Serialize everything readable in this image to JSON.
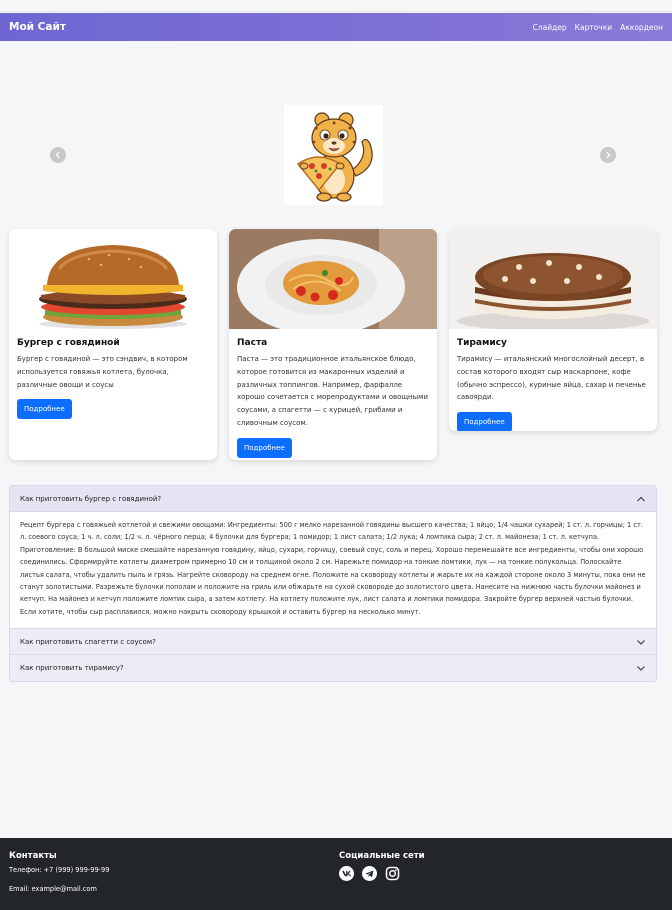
{
  "navbar": {
    "brand": "Мой Сайт",
    "links": [
      "Слайдер",
      "Карточки",
      "Аккордеон"
    ]
  },
  "cards": [
    {
      "title": "Бургер с говядиной",
      "text": "Бургер с говядиной — это сэндвич, в котором используется говяжья котлета, булочка, различные овощи и соусы",
      "button": "Подробнее"
    },
    {
      "title": "Паста",
      "text": "Паста — это традиционное итальянское блюдо, которое готовится из макаронных изделий и различных топпингов. Например, фарфалле хорошо сочетается с морепродуктами и овощными соусами, а спагетти — с курицей, грибами и сливочным соусом.",
      "button": "Подробнее"
    },
    {
      "title": "Тирамису",
      "text": "Тирамису — итальянский многослойный десерт, в состав которого входят сыр маскарпоне, кофе (обычно эспрессо), куриные яйца, сахар и печенье савоярди.",
      "button": "Подробнее"
    }
  ],
  "accordion": {
    "items": [
      {
        "title": "Как приготовить бургер с говядиной?",
        "open": true,
        "body": "Рецепт бургера с говяжьей котлетой и свежими овощами: Ингредиенты: 500 г мелко нарезанной говядины высшего качества; 1 яйцо; 1/4 чашки сухарей; 1 ст. л. горчицы; 1 ст. л. соевого соуса; 1 ч. л. соли; 1/2 ч. л. чёрного перца; 4 булочки для бургера; 1 помидор; 1 лист салата; 1/2 лука; 4 ломтика сыра; 2 ст. л. майонеза; 1 ст. л. кетчупа. Приготовление: В большой миске смешайте нарезанную говядину, яйцо, сухари, горчицу, соевый соус, соль и перец. Хорошо перемешайте все ингредиенты, чтобы они хорошо соединились. Сформируйте котлеты диаметром примерно 10 см и толщиной около 2 см. Нарежьте помидор на тонкие ломтики, лук — на тонкие полукольца. Полоскайте листья салата, чтобы удалить пыль и грязь. Нагрейте сковороду на среднем огне. Положите на сковороду котлеты и жарьте их на каждой стороне около 3 минуты, пока они не станут золотистыми. Разрежьте булочки пополам и положите на гриль или обжарьте на сухой сковороде до золотистого цвета. Нанесите на нижнюю часть булочки майонез и кетчуп. На майонез и кетчуп положите ломтик сыра, а затем котлету. На котлету положите лук, лист салата и ломтики помидора. Закройте бургер верхней частью булочки. Если хотите, чтобы сыр расплавился, можно накрыть сковороду крышкой и оставить бургер на несколько минут."
      },
      {
        "title": "Как приготовить спагетти с соусом?",
        "open": false
      },
      {
        "title": "Как приготовить тирамису?",
        "open": false
      }
    ]
  },
  "footer": {
    "contacts_title": "Контакты",
    "phone": "Телефон: +7 (999) 999-99-99",
    "email": "Email: example@mail.com",
    "social_title": "Социальные сети",
    "social_icons": [
      "vk-icon",
      "telegram-icon",
      "instagram-icon"
    ]
  },
  "colors": {
    "navbar_start": "#6f66d3",
    "button": "#0d6efd",
    "footer": "#22262b"
  }
}
